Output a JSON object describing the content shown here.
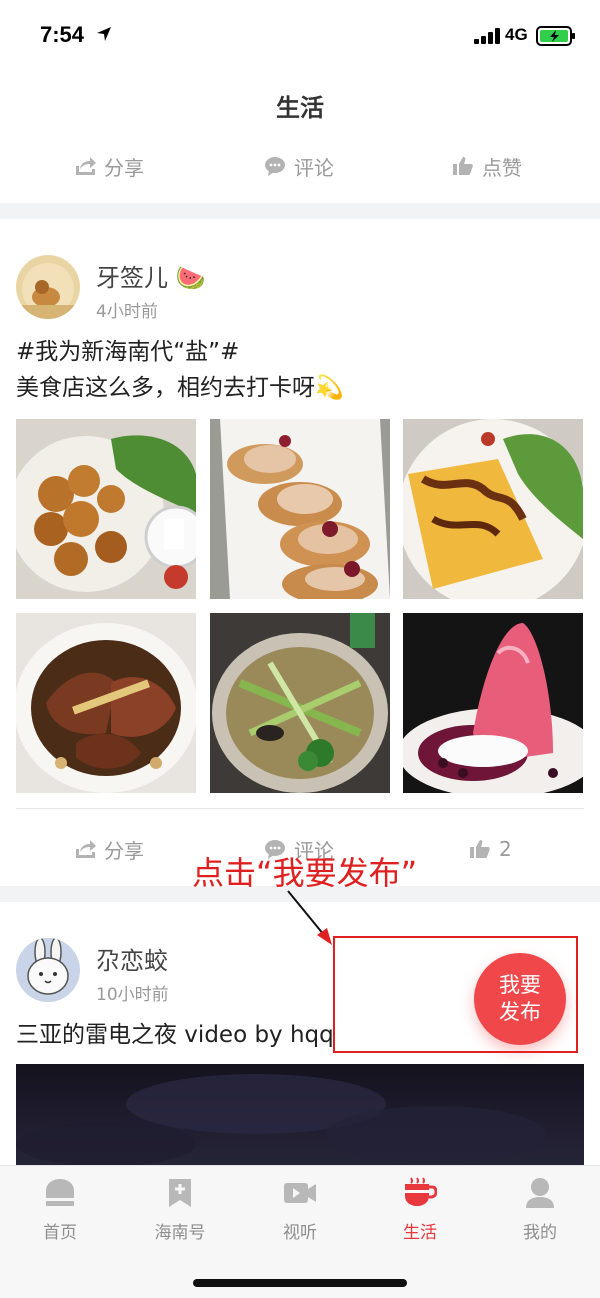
{
  "status_bar": {
    "time": "7:54",
    "network": "4G"
  },
  "page": {
    "title": "生活"
  },
  "top_actions": {
    "share": "分享",
    "comment": "评论",
    "like": "点赞"
  },
  "posts": [
    {
      "username": "牙签儿",
      "emoji": "🍉",
      "time": "4小时前",
      "text_line1": "#我为新海南代“盐”#",
      "text_line2": "美食店这么多，相约去打卡呀💫",
      "photos": [
        "fried-chicken-salad",
        "bruschetta-plate",
        "omelette-rice-salad",
        "braised-pork",
        "vegetable-stew",
        "red-dessert-ice"
      ],
      "actions": {
        "share": "分享",
        "comment": "评论",
        "like_count": "2"
      }
    },
    {
      "username": "尕恋蛟",
      "time": "10小时前",
      "text": "三亚的雷电之夜 video by hqq"
    }
  ],
  "annotation": {
    "text": "点击“我要发布”"
  },
  "fab": {
    "line1": "我要",
    "line2": "发布"
  },
  "tabbar": {
    "items": [
      {
        "label": "首页",
        "icon": "home-icon"
      },
      {
        "label": "海南号",
        "icon": "bookmark-icon"
      },
      {
        "label": "视听",
        "icon": "video-icon"
      },
      {
        "label": "生活",
        "icon": "cup-icon"
      },
      {
        "label": "我的",
        "icon": "person-icon"
      }
    ],
    "active_index": 3
  },
  "colors": {
    "accent": "#e8383d",
    "fab": "#f0474b",
    "annotation": "#e02020",
    "muted": "#9a9a9a"
  }
}
